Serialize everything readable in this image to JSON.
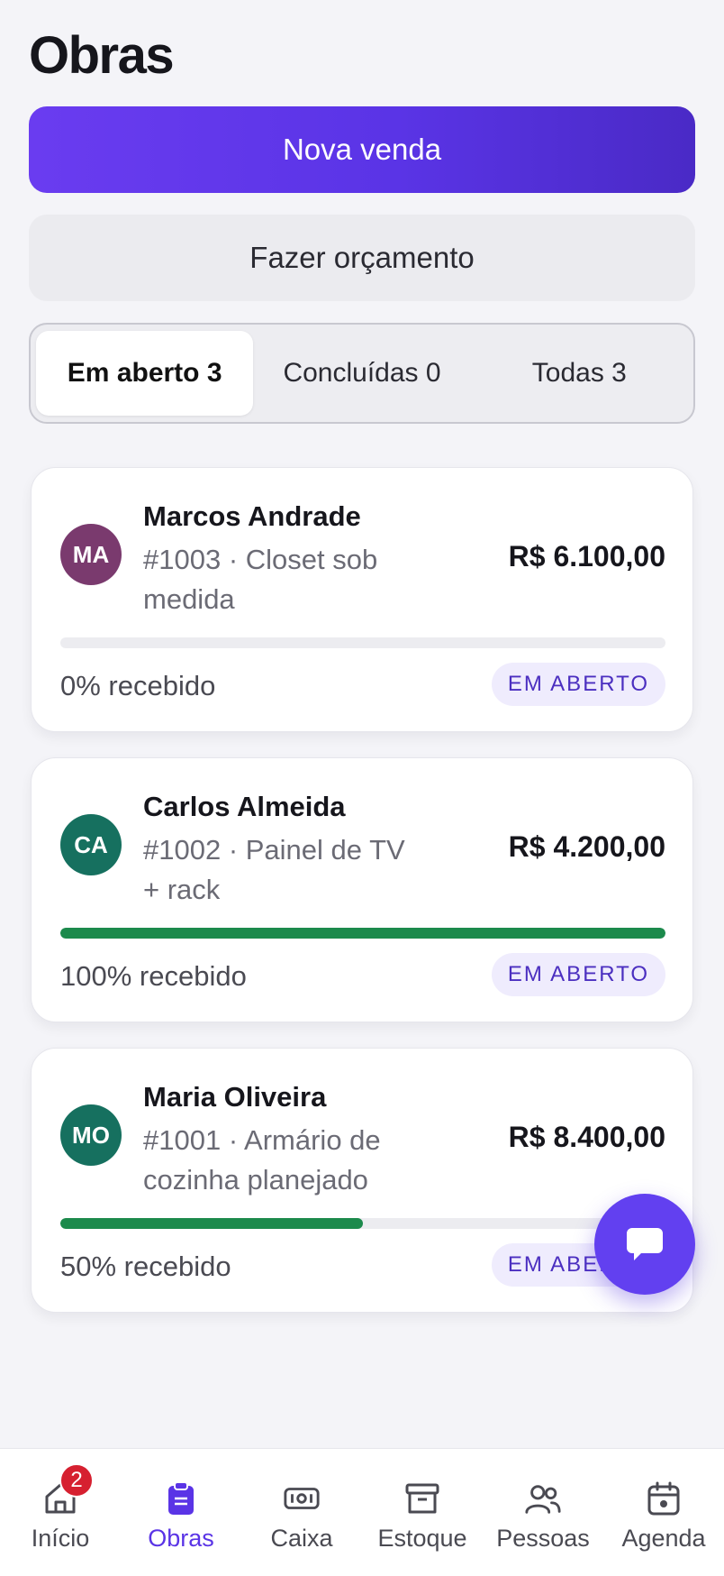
{
  "page": {
    "title": "Obras"
  },
  "actions": {
    "primary_label": "Nova venda",
    "secondary_label": "Fazer orçamento"
  },
  "tabs": [
    {
      "label": "Em aberto 3",
      "active": true
    },
    {
      "label": "Concluídas 0",
      "active": false
    },
    {
      "label": "Todas 3",
      "active": false
    }
  ],
  "orders": [
    {
      "initials": "MA",
      "avatar_color": "#7a3a6e",
      "client": "Marcos Andrade",
      "description": "#1003 · Closet sob medida",
      "amount": "R$ 6.100,00",
      "received_pct": 0,
      "received_label": "0% recebido",
      "status": "EM ABERTO"
    },
    {
      "initials": "CA",
      "avatar_color": "#16705f",
      "client": "Carlos Almeida",
      "description": "#1002 · Painel de TV + rack",
      "amount": "R$ 4.200,00",
      "received_pct": 100,
      "received_label": "100% recebido",
      "status": "EM ABERTO"
    },
    {
      "initials": "MO",
      "avatar_color": "#16705f",
      "client": "Maria Oliveira",
      "description": "#1001 · Armário de cozinha planejado",
      "amount": "R$ 8.400,00",
      "received_pct": 50,
      "received_label": "50% recebido",
      "status": "EM ABERTO"
    }
  ],
  "colors": {
    "accent": "#5a34e6",
    "progress": "#1c8a4c",
    "badge": "#d62030"
  },
  "nav": [
    {
      "label": "Início",
      "icon": "home-icon",
      "badge": "2",
      "active": false
    },
    {
      "label": "Obras",
      "icon": "clipboard-icon",
      "active": true
    },
    {
      "label": "Caixa",
      "icon": "cash-icon",
      "active": false
    },
    {
      "label": "Estoque",
      "icon": "archive-box-icon",
      "active": false
    },
    {
      "label": "Pessoas",
      "icon": "people-icon",
      "active": false
    },
    {
      "label": "Agenda",
      "icon": "calendar-icon",
      "active": false
    }
  ]
}
